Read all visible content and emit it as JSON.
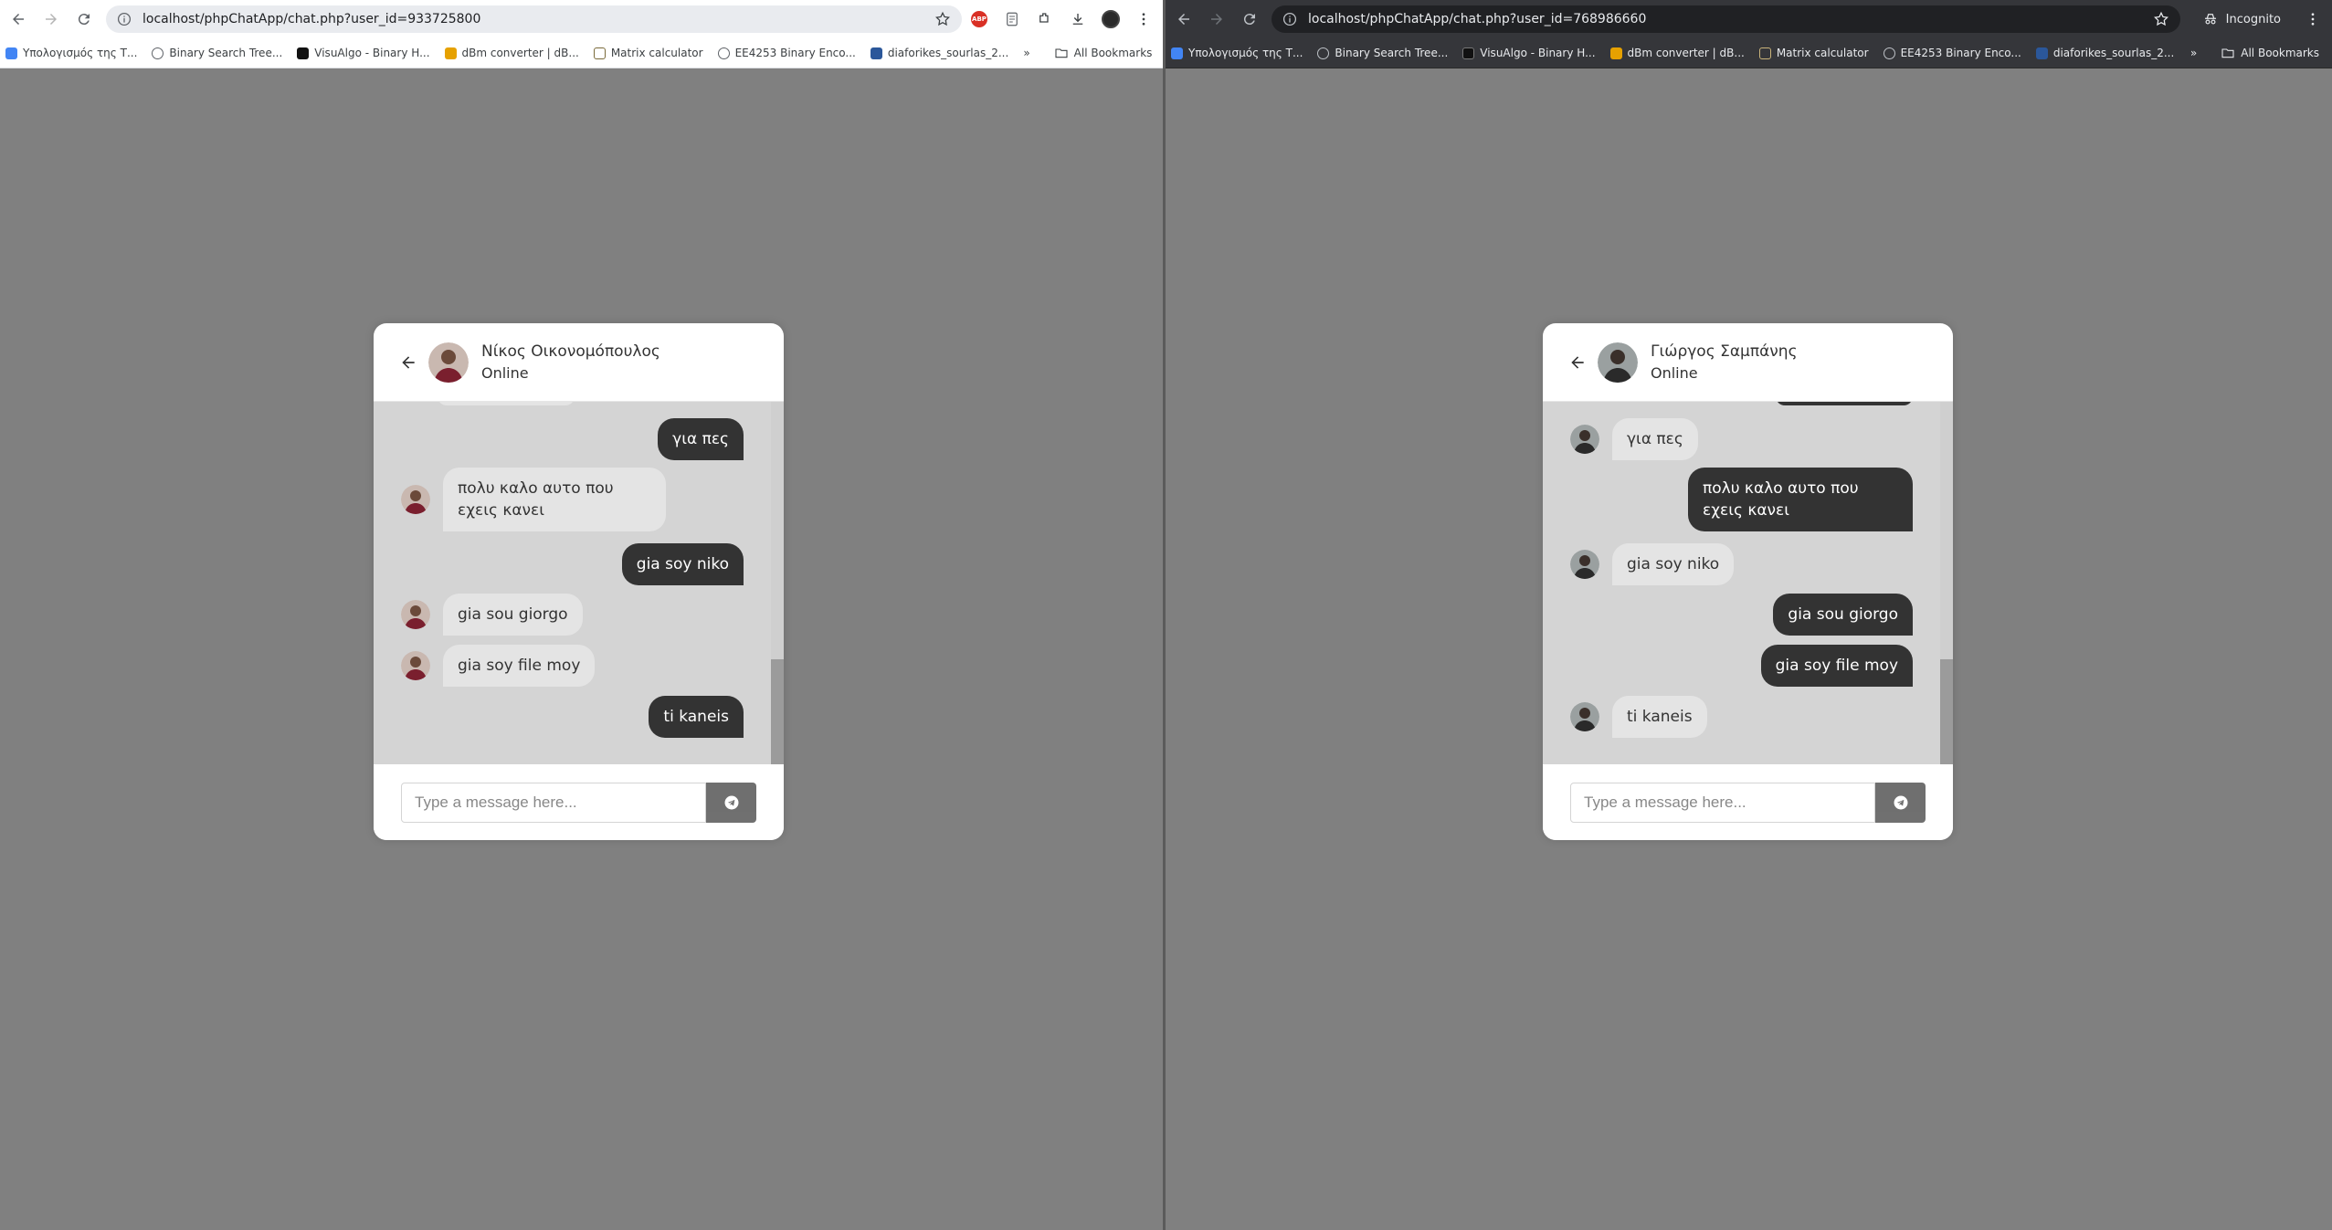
{
  "left": {
    "url": "localhost/phpChatApp/chat.php?user_id=933725800",
    "bookmarks": [
      "Υπολογισμός της Τ...",
      "Binary Search Tree...",
      "VisuAlgo - Binary H...",
      "dBm converter | dB...",
      "Matrix calculator",
      "EE4253 Binary Enco...",
      "diaforikes_sourlas_2..."
    ],
    "all_bookmarks": "All Bookmarks",
    "chat": {
      "name": "Νίκος Οικονομόπουλος",
      "status": "Online",
      "messages": [
        {
          "dir": "out",
          "text": "για πες"
        },
        {
          "dir": "in",
          "text": "πολυ καλο αυτο που εχεις κανει"
        },
        {
          "dir": "out",
          "text": "gia soy niko"
        },
        {
          "dir": "in",
          "text": "gia sou giorgo"
        },
        {
          "dir": "in",
          "text": "gia soy file moy"
        },
        {
          "dir": "out",
          "text": "ti kaneis"
        }
      ],
      "placeholder": "Type a message here..."
    }
  },
  "right": {
    "url": "localhost/phpChatApp/chat.php?user_id=768986660",
    "incognito": "Incognito",
    "bookmarks": [
      "Υπολογισμός της Τ...",
      "Binary Search Tree...",
      "VisuAlgo - Binary H...",
      "dBm converter | dB...",
      "Matrix calculator",
      "EE4253 Binary Enco...",
      "diaforikes_sourlas_2..."
    ],
    "all_bookmarks": "All Bookmarks",
    "chat": {
      "name": "Γιώργος Σαμπάνης",
      "status": "Online",
      "messages": [
        {
          "dir": "in",
          "text": "για πες"
        },
        {
          "dir": "out",
          "text": "πολυ καλο αυτο που εχεις κανει"
        },
        {
          "dir": "in",
          "text": "gia soy niko"
        },
        {
          "dir": "out",
          "text": "gia sou giorgo"
        },
        {
          "dir": "out",
          "text": "gia soy file moy"
        },
        {
          "dir": "in",
          "text": "ti kaneis"
        }
      ],
      "placeholder": "Type a message here..."
    }
  },
  "icons": {
    "back": "arrow-left-icon",
    "send": "telegram-send-icon",
    "star": "star-icon",
    "reload": "reload-icon",
    "folder": "folder-icon"
  },
  "colors": {
    "page_bg": "#808080",
    "outgoing_bubble": "#333333",
    "incoming_bubble": "#e4e4e4",
    "chat_bg": "#d4d4d4"
  }
}
